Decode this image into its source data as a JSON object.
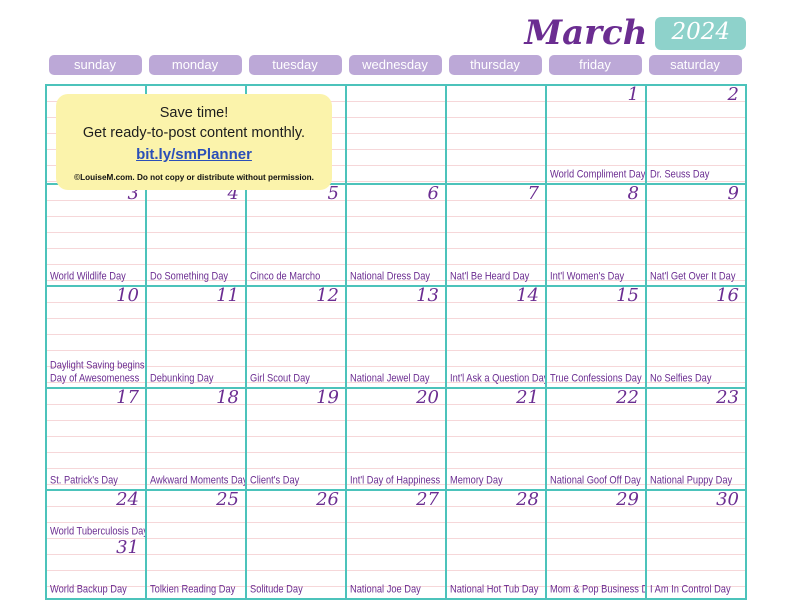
{
  "header": {
    "month": "March",
    "year": "2024",
    "accent_purple": "#6b2d91",
    "accent_teal": "#8ed2cb",
    "pill_purple": "#bca8d7",
    "rule_pink": "#f6d7d9"
  },
  "weekdays": [
    {
      "label": "sunday"
    },
    {
      "label": "monday"
    },
    {
      "label": "tuesday"
    },
    {
      "label": "wednesday"
    },
    {
      "label": "thursday"
    },
    {
      "label": "friday"
    },
    {
      "label": "saturday"
    }
  ],
  "promo": {
    "line1": "Save time!",
    "line2": "Get ready-to-post content monthly.",
    "link": "bit.ly/smPlanner",
    "copyright": "©LouiseM.com. Do not copy or distribute without permission."
  },
  "weeks": [
    {
      "days": [
        {
          "num": "",
          "event": ""
        },
        {
          "num": "",
          "event": ""
        },
        {
          "num": "",
          "event": ""
        },
        {
          "num": "",
          "event": ""
        },
        {
          "num": "",
          "event": ""
        },
        {
          "num": "1",
          "event": "World Compliment Day"
        },
        {
          "num": "2",
          "event": "Dr. Seuss Day"
        }
      ]
    },
    {
      "days": [
        {
          "num": "3",
          "event": "World Wildlife Day"
        },
        {
          "num": "4",
          "event": "Do Something Day"
        },
        {
          "num": "5",
          "event": "Cinco de Marcho"
        },
        {
          "num": "6",
          "event": "National Dress Day"
        },
        {
          "num": "7",
          "event": "Nat'l Be Heard Day"
        },
        {
          "num": "8",
          "event": "Int'l Women's Day"
        },
        {
          "num": "9",
          "event": "Nat'l Get Over It Day"
        }
      ]
    },
    {
      "days": [
        {
          "num": "10",
          "event": "Day of Awesomeness",
          "event2": "Daylight Saving begins"
        },
        {
          "num": "11",
          "event": "Debunking Day"
        },
        {
          "num": "12",
          "event": "Girl Scout Day"
        },
        {
          "num": "13",
          "event": "National Jewel Day"
        },
        {
          "num": "14",
          "event": "Int'l Ask a Question Day"
        },
        {
          "num": "15",
          "event": "True Confessions Day"
        },
        {
          "num": "16",
          "event": "No Selfies Day"
        }
      ]
    },
    {
      "days": [
        {
          "num": "17",
          "event": "St. Patrick's Day"
        },
        {
          "num": "18",
          "event": "Awkward Moments Day"
        },
        {
          "num": "19",
          "event": "Client's Day"
        },
        {
          "num": "20",
          "event": "Int'l Day of Happiness"
        },
        {
          "num": "21",
          "event": "Memory Day"
        },
        {
          "num": "22",
          "event": "National Goof Off Day"
        },
        {
          "num": "23",
          "event": "National Puppy Day"
        }
      ]
    },
    {
      "days": [
        {
          "num": "24",
          "event": "World Backup Day",
          "event_mid": "World Tuberculosis Day",
          "num_mid": "31"
        },
        {
          "num": "25",
          "event": "Tolkien Reading Day"
        },
        {
          "num": "26",
          "event": "Solitude Day"
        },
        {
          "num": "27",
          "event": "National Joe Day"
        },
        {
          "num": "28",
          "event": "National Hot Tub Day"
        },
        {
          "num": "29",
          "event": "Mom & Pop Business Day"
        },
        {
          "num": "30",
          "event": "I Am In Control Day"
        }
      ]
    }
  ]
}
